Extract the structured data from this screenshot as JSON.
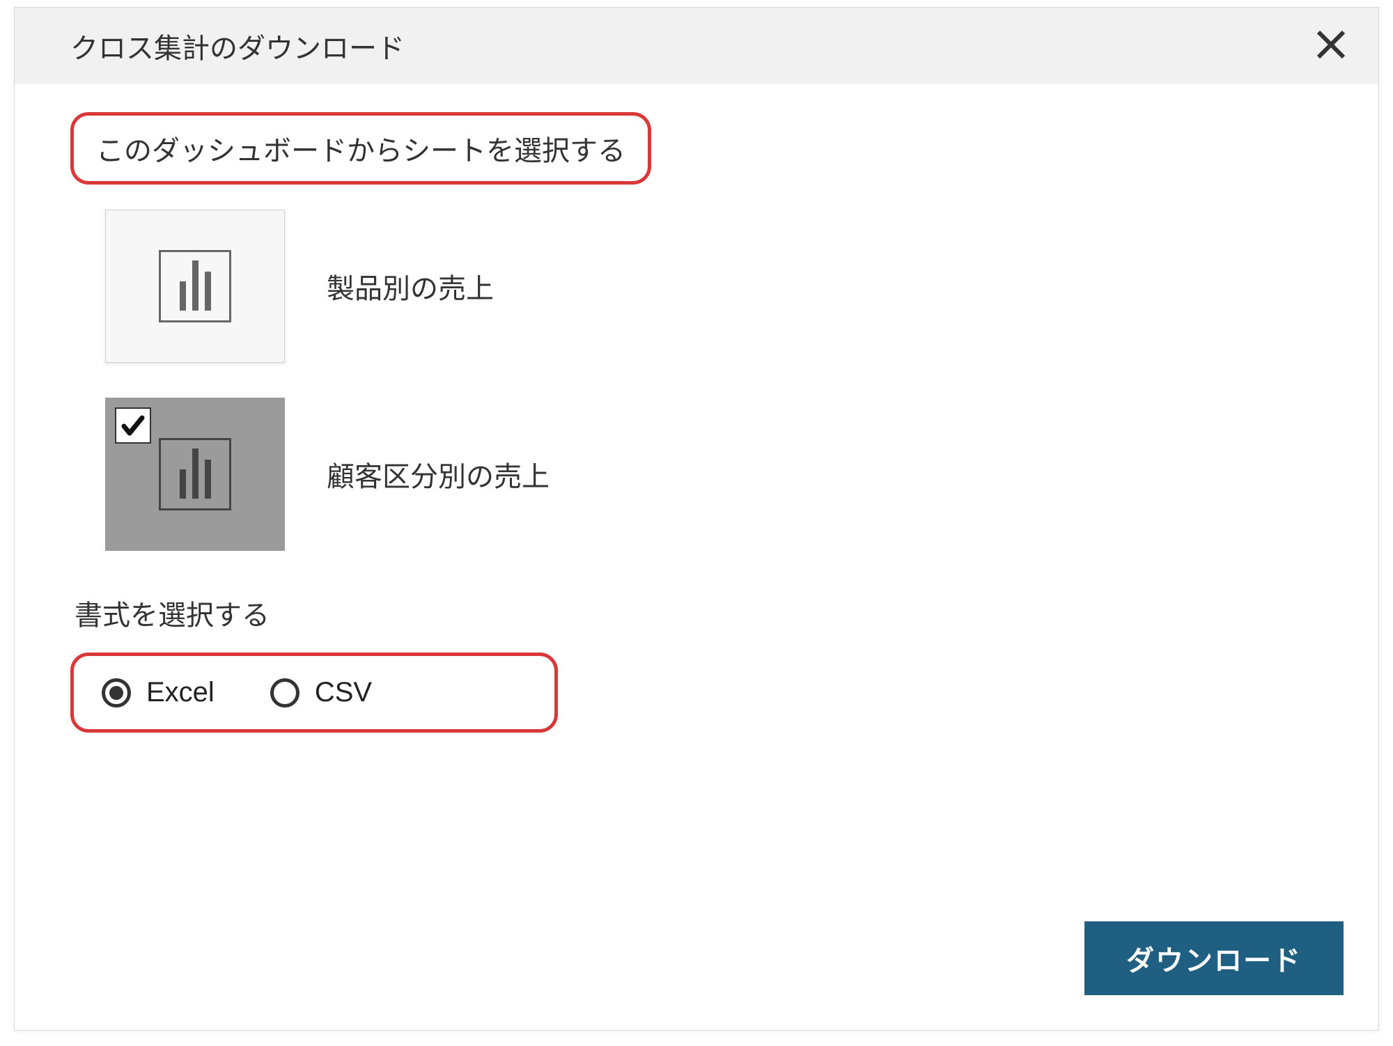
{
  "header": {
    "title": "クロス集計のダウンロード"
  },
  "sections": {
    "select_sheet_heading": "このダッシュボードからシートを選択する",
    "format_heading": "書式を選択する"
  },
  "sheets": [
    {
      "label": "製品別の売上",
      "selected": false
    },
    {
      "label": "顧客区分別の売上",
      "selected": true
    }
  ],
  "formats": {
    "excel": {
      "label": "Excel",
      "checked": true
    },
    "csv": {
      "label": "CSV",
      "checked": false
    }
  },
  "footer": {
    "download_label": "ダウンロード"
  },
  "colors": {
    "highlight_border": "#d93838",
    "primary_button_bg": "#1e5f82"
  }
}
